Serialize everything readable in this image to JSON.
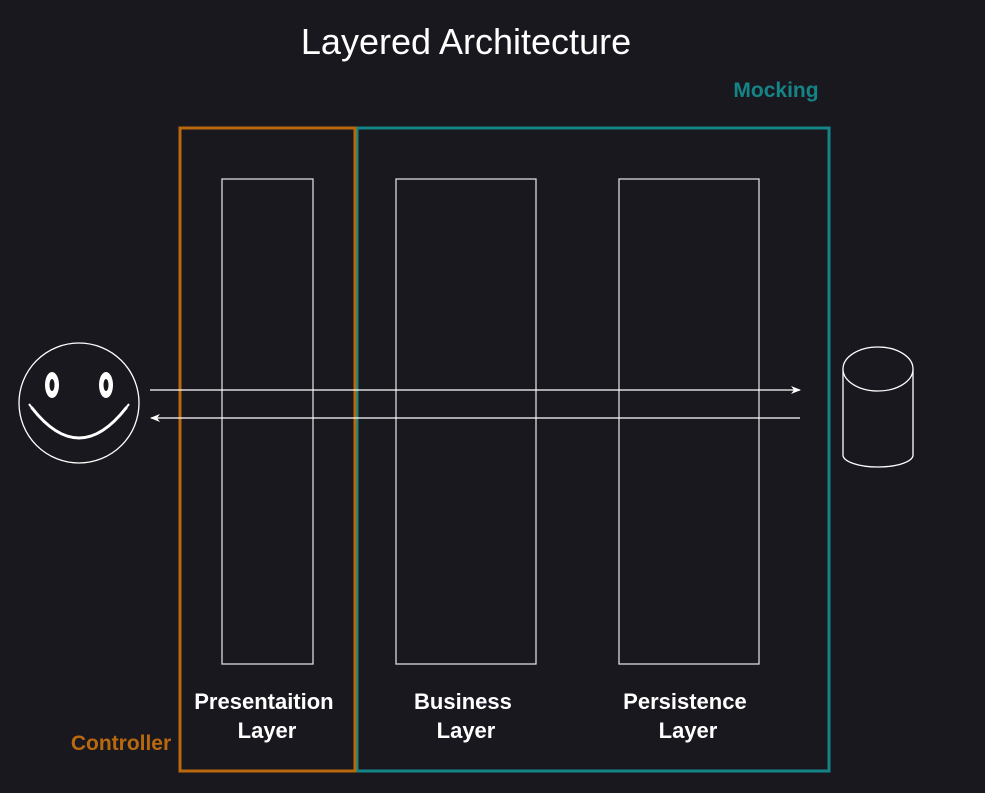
{
  "title": "Layered Architecture",
  "groups": {
    "mocking": {
      "label": "Mocking",
      "color": "#148587"
    },
    "controller": {
      "label": "Controller",
      "color": "#b8690e"
    }
  },
  "layers": [
    {
      "line1": "Presentaition",
      "line2": "Layer"
    },
    {
      "line1": "Business",
      "line2": "Layer"
    },
    {
      "line1": "Persistence",
      "line2": "Layer"
    }
  ],
  "nodes": {
    "user": {
      "icon": "smiley-face-icon"
    },
    "database": {
      "icon": "database-cylinder-icon"
    }
  },
  "flows": [
    {
      "from": "user",
      "to": "database",
      "direction": "request"
    },
    {
      "from": "database",
      "to": "user",
      "direction": "response"
    }
  ],
  "colors": {
    "background": "#1a181f",
    "stroke": "#ffffff",
    "controller": "#b8690e",
    "mocking": "#148587"
  }
}
